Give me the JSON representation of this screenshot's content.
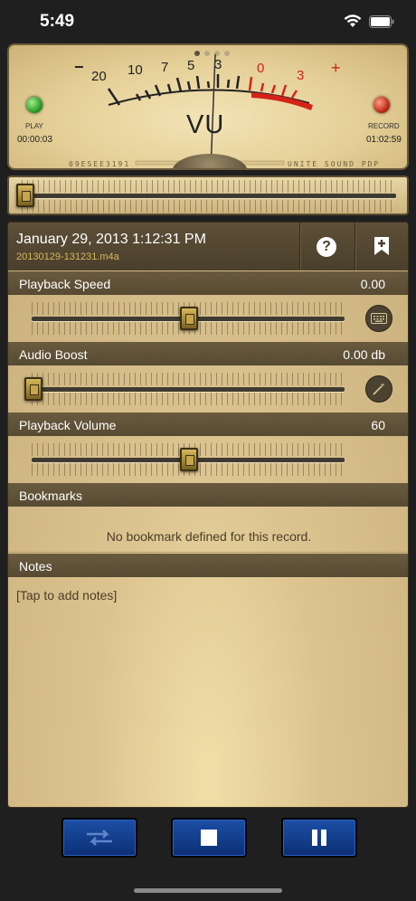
{
  "status_bar": {
    "time": "5:49"
  },
  "vu_meter": {
    "label": "VU",
    "scale_left": [
      "−",
      "20",
      "10",
      "7",
      "5",
      "3"
    ],
    "scale_right": [
      "0",
      "3",
      "+"
    ],
    "play_label": "PLAY",
    "play_time": "00:00:03",
    "record_label": "RECORD",
    "record_time": "01:02:59",
    "page_dots": 4,
    "active_dot": 0,
    "serial_left": "09ESEE3191",
    "serial_right": "UNITE SOUND PDP",
    "colors": {
      "red": "#d42318",
      "face": "#ecd9a6"
    }
  },
  "seek": {
    "position": 0.0
  },
  "record": {
    "date": "January 29, 2013 1:12:31 PM",
    "filename": "20130129-131231.m4a",
    "help_icon": "question-circle-icon",
    "add_bookmark_icon": "bookmark-plus-icon"
  },
  "playback_speed": {
    "label": "Playback Speed",
    "value": "0.00",
    "slider_position": 0.5,
    "icon": "keyboard-icon"
  },
  "audio_boost": {
    "label": "Audio Boost",
    "value": "0.00 db",
    "slider_position": 0.0,
    "icon": "magic-wand-icon"
  },
  "playback_volume": {
    "label": "Playback Volume",
    "value": "60",
    "slider_position": 0.5
  },
  "bookmarks": {
    "label": "Bookmarks",
    "empty_text": "No bookmark defined for this record."
  },
  "notes": {
    "label": "Notes",
    "placeholder": "[Tap to add notes]"
  },
  "controls": {
    "buttons": [
      "shuffle-icon",
      "stop-icon",
      "pause-icon"
    ],
    "color": "#123f8f"
  }
}
